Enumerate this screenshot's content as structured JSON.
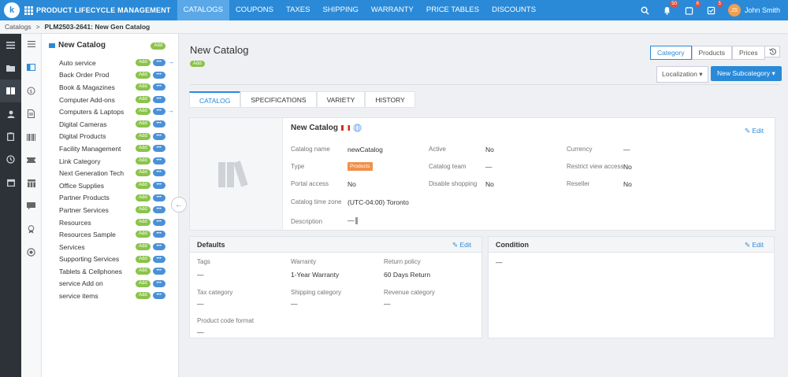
{
  "app": {
    "name": "PRODUCT LIFECYCLE MANAGEMENT",
    "logo_letter": "k"
  },
  "nav": {
    "tabs": [
      "CATALOGS",
      "COUPONS",
      "TAXES",
      "SHIPPING",
      "WARRANTY",
      "PRICE TABLES",
      "DISCOUNTS"
    ],
    "active": "CATALOGS"
  },
  "topright": {
    "bell_count": "50",
    "tasks_count": "6",
    "check_count": "5",
    "avatar_initials": "JS",
    "user_name": "John Smith"
  },
  "breadcrumb": {
    "root": "Catalogs",
    "separator": ">",
    "current": "PLM2503-2641: New Gen Catalog"
  },
  "tree": {
    "title": "New Catalog",
    "add_label": "Add",
    "more_label": "•••",
    "items": [
      {
        "label": "Auto service",
        "arrow": true
      },
      {
        "label": "Back Order Prod"
      },
      {
        "label": "Book & Magazines"
      },
      {
        "label": "Computer Add-ons"
      },
      {
        "label": "Computers & Laptops",
        "arrow": true
      },
      {
        "label": "Digital Cameras"
      },
      {
        "label": "Digital Products"
      },
      {
        "label": "Facility Management"
      },
      {
        "label": "Link Category"
      },
      {
        "label": "Next Generation Tech"
      },
      {
        "label": "Office Supplies"
      },
      {
        "label": "Partner Products"
      },
      {
        "label": "Partner Services"
      },
      {
        "label": "Resources"
      },
      {
        "label": "Resources Sample"
      },
      {
        "label": "Services"
      },
      {
        "label": "Supporting Services"
      },
      {
        "label": "Tablets & Cellphones"
      },
      {
        "label": "service Add on"
      },
      {
        "label": "service items"
      }
    ]
  },
  "page": {
    "title": "New Catalog",
    "add_badge": "Add",
    "views": [
      "Category",
      "Products",
      "Prices"
    ],
    "active_view": "Category",
    "localization_label": "Localization",
    "new_subcategory_label": "New Subcategory",
    "tabs": [
      "CATALOG",
      "SPECIFICATIONS",
      "VARIETY",
      "HISTORY"
    ],
    "active_tab": "CATALOG"
  },
  "info": {
    "title": "New Catalog",
    "edit_label": "Edit",
    "catalog_name_label": "Catalog name",
    "catalog_name": "newCatalog",
    "type_label": "Type",
    "type": "Products",
    "portal_access_label": "Portal access",
    "portal_access": "No",
    "time_zone_label": "Catalog time zone",
    "time_zone": "(UTC-04:00) Toronto",
    "description_label": "Description",
    "description": "—",
    "active_label": "Active",
    "active": "No",
    "catalog_team_label": "Catalog team",
    "catalog_team": "—",
    "disable_shopping_label": "Disable shopping",
    "disable_shopping": "No",
    "currency_label": "Currency",
    "currency": "—",
    "restrict_label": "Restrict view access",
    "restrict": "No",
    "reseller_label": "Reseller",
    "reseller": "No"
  },
  "defaults": {
    "title": "Defaults",
    "edit_label": "Edit",
    "tags_label": "Tags",
    "tags": "—",
    "warranty_label": "Warranty",
    "warranty": "1-Year Warranty",
    "return_label": "Return policy",
    "return": "60 Days Return",
    "tax_label": "Tax category",
    "tax": "—",
    "shipping_label": "Shipping category",
    "shipping": "—",
    "revenue_label": "Revenue category",
    "revenue": "—",
    "code_label": "Product code format",
    "code": "—"
  },
  "condition": {
    "title": "Condition",
    "edit_label": "Edit",
    "value": "—"
  }
}
